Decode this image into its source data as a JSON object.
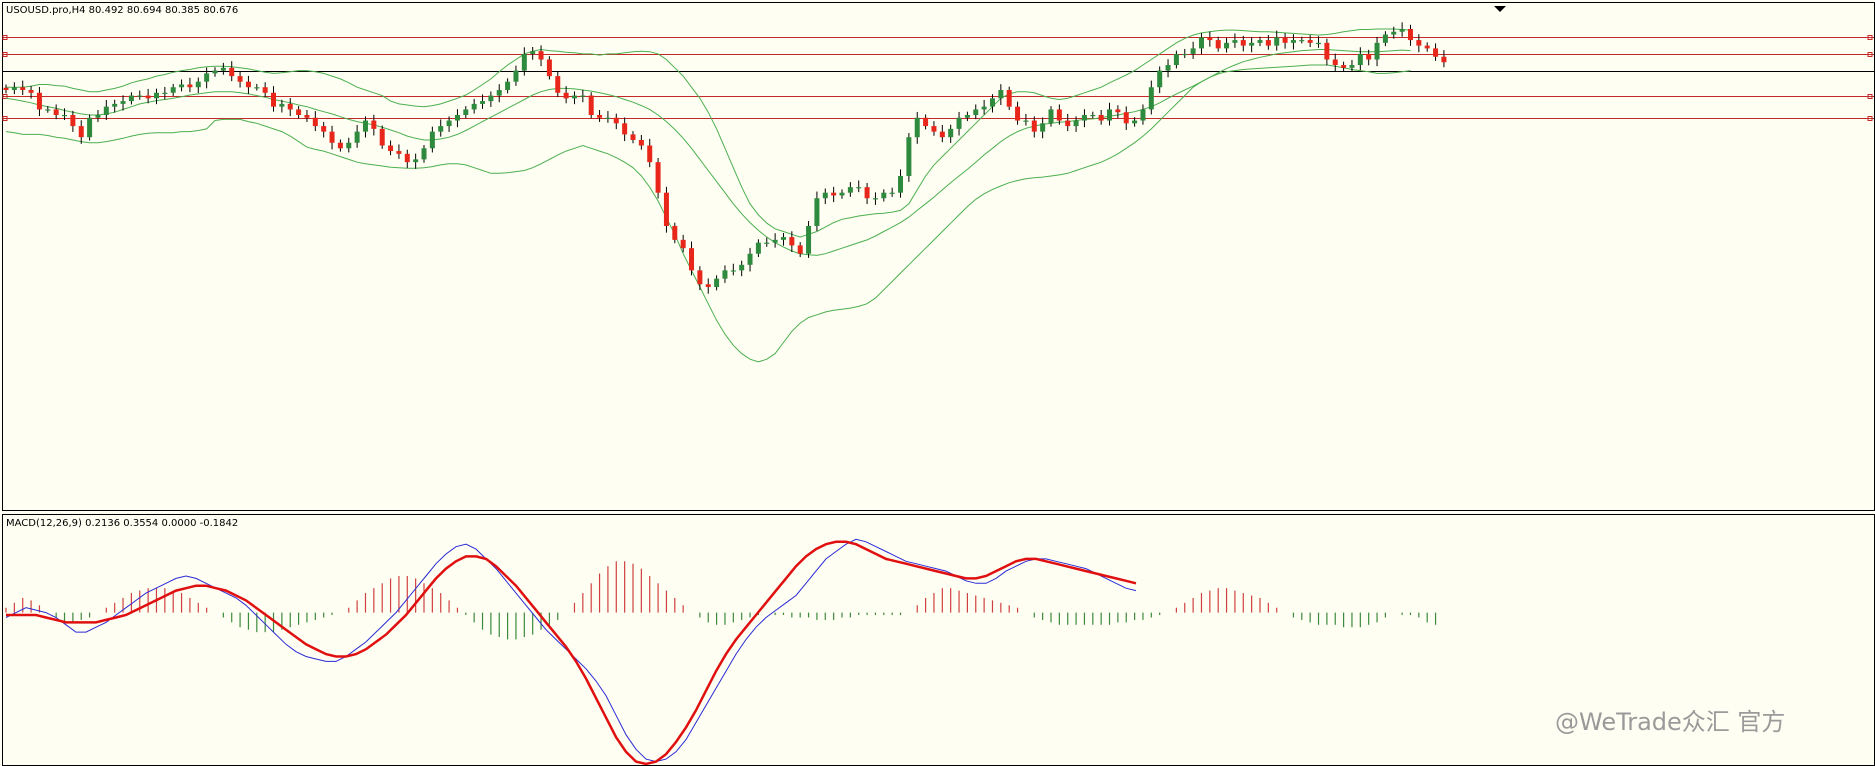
{
  "colors": {
    "background": "#fefef2",
    "frame": "#000000",
    "bull_candle": "#2e8b3e",
    "bear_candle": "#e8261a",
    "bollinger": "#4caf50",
    "level_line": "#c62828",
    "price_line": "#000000",
    "macd_line": "#2a2ad6",
    "signal_line": "#e01010",
    "hist_pos": "#d04040",
    "hist_neg": "#3c8a3c"
  },
  "header": {
    "symbol_info": "USOUSD.pro,H4  80.492 80.694 80.385 80.676"
  },
  "macd_panel": {
    "label": "MACD(12,26,9) 0.2136 0.3554 0.0000 -0.1842"
  },
  "watermark": {
    "text": "@WeTrade众汇 官方"
  },
  "chart_data": [
    {
      "type": "candlestick",
      "title": "USOUSD.pro,H4  80.492 80.694 80.385 80.676",
      "timeframe": "H4",
      "ylim": [
        74.5,
        83.6
      ],
      "levels": [
        83.0,
        82.7,
        81.95,
        81.55
      ],
      "current_price": 82.4,
      "close": [
        82.05,
        82.1,
        82.05,
        82.0,
        81.7,
        81.7,
        81.6,
        81.6,
        81.4,
        81.2,
        81.55,
        81.6,
        81.75,
        81.8,
        81.85,
        81.95,
        81.95,
        81.9,
        82.0,
        82.0,
        82.1,
        82.15,
        82.1,
        82.2,
        82.35,
        82.4,
        82.45,
        82.3,
        82.2,
        82.1,
        82.1,
        82.0,
        81.75,
        81.8,
        81.7,
        81.6,
        81.55,
        81.4,
        81.3,
        81.1,
        81.0,
        81.1,
        81.3,
        81.5,
        81.35,
        81.05,
        80.95,
        80.9,
        80.75,
        80.8,
        81.0,
        81.3,
        81.4,
        81.5,
        81.6,
        81.7,
        81.8,
        81.85,
        81.95,
        82.05,
        82.2,
        82.4,
        82.7,
        82.75,
        82.6,
        82.3,
        82.0,
        81.9,
        81.95,
        81.95,
        81.6,
        81.55,
        81.55,
        81.45,
        81.25,
        81.15,
        81.05,
        80.75,
        80.2,
        79.6,
        79.35,
        79.2,
        78.8,
        78.55,
        78.5,
        78.65,
        78.8,
        78.8,
        78.9,
        79.1,
        79.3,
        79.3,
        79.35,
        79.4,
        79.25,
        79.1,
        79.6,
        80.1,
        80.2,
        80.15,
        80.2,
        80.3,
        80.3,
        80.1,
        80.1,
        80.2,
        80.2,
        80.5,
        81.2,
        81.55,
        81.4,
        81.3,
        81.2,
        81.35,
        81.55,
        81.6,
        81.7,
        81.75,
        81.9,
        82.05,
        81.75,
        81.5,
        81.5,
        81.3,
        81.45,
        81.7,
        81.5,
        81.4,
        81.5,
        81.6,
        81.6,
        81.5,
        81.7,
        81.65,
        81.45,
        81.5,
        81.7,
        82.1,
        82.4,
        82.5,
        82.7,
        82.7,
        82.8,
        83.0,
        82.95,
        82.8,
        82.9,
        82.95,
        82.85,
        82.9,
        82.95,
        82.85,
        83.0,
        82.9,
        82.95,
        82.95,
        82.9,
        82.9,
        82.6,
        82.5,
        82.45,
        82.5,
        82.7,
        82.6,
        82.9,
        83.05,
        83.1,
        83.15,
        82.95,
        82.85,
        82.8,
        82.65,
        82.55
      ],
      "bollinger_upper": [
        82.1,
        82.1,
        82.1,
        82.12,
        82.15,
        82.15,
        82.13,
        82.12,
        82.08,
        82.05,
        82.02,
        82.02,
        82.05,
        82.08,
        82.12,
        82.18,
        82.22,
        82.25,
        82.3,
        82.33,
        82.37,
        82.4,
        82.42,
        82.45,
        82.47,
        82.48,
        82.48,
        82.47,
        82.45,
        82.43,
        82.4,
        82.37,
        82.35,
        82.36,
        82.38,
        82.4,
        82.4,
        82.38,
        82.35,
        82.3,
        82.25,
        82.18,
        82.1,
        82.05,
        82.0,
        81.95,
        81.85,
        81.8,
        81.78,
        81.76,
        81.75,
        81.77,
        81.8,
        81.85,
        81.9,
        81.96,
        82.05,
        82.15,
        82.25,
        82.38,
        82.5,
        82.6,
        82.7,
        82.75,
        82.78,
        82.76,
        82.75,
        82.73,
        82.72,
        82.7,
        82.7,
        82.68,
        82.7,
        82.7,
        82.72,
        82.74,
        82.75,
        82.74,
        82.7,
        82.6,
        82.45,
        82.3,
        82.1,
        81.9,
        81.65,
        81.35,
        81.0,
        80.65,
        80.3,
        80.0,
        79.8,
        79.65,
        79.55,
        79.5,
        79.45,
        79.4,
        79.45,
        79.5,
        79.58,
        79.66,
        79.72,
        79.75,
        79.78,
        79.8,
        79.82,
        79.83,
        79.85,
        79.88,
        80.0,
        80.25,
        80.5,
        80.7,
        80.85,
        81.0,
        81.15,
        81.3,
        81.45,
        81.6,
        81.75,
        81.9,
        81.98,
        82.02,
        82.02,
        82.0,
        81.95,
        81.9,
        81.88,
        81.9,
        81.95,
        82.0,
        82.05,
        82.1,
        82.18,
        82.25,
        82.32,
        82.4,
        82.5,
        82.6,
        82.7,
        82.8,
        82.9,
        82.98,
        83.04,
        83.08,
        83.1,
        83.12,
        83.13,
        83.13,
        83.12,
        83.11,
        83.1,
        83.1,
        83.09,
        83.08,
        83.07,
        83.06,
        83.05,
        83.04,
        83.05,
        83.07,
        83.1,
        83.12,
        83.14,
        83.14,
        83.15,
        83.15,
        83.15,
        83.14,
        83.13
      ],
      "bollinger_middle": [
        81.9,
        81.88,
        81.85,
        81.82,
        81.78,
        81.75,
        81.72,
        81.68,
        81.65,
        81.62,
        81.6,
        81.6,
        81.62,
        81.65,
        81.7,
        81.75,
        81.8,
        81.83,
        81.86,
        81.88,
        81.9,
        81.93,
        81.96,
        81.98,
        82.0,
        82.02,
        82.02,
        82.02,
        82.0,
        81.98,
        81.95,
        81.92,
        81.88,
        81.85,
        81.82,
        81.78,
        81.75,
        81.7,
        81.66,
        81.62,
        81.57,
        81.52,
        81.48,
        81.45,
        81.42,
        81.38,
        81.33,
        81.28,
        81.22,
        81.18,
        81.15,
        81.15,
        81.17,
        81.2,
        81.25,
        81.32,
        81.4,
        81.48,
        81.56,
        81.64,
        81.72,
        81.8,
        81.88,
        81.96,
        82.02,
        82.06,
        82.08,
        82.08,
        82.07,
        82.05,
        82.03,
        82.0,
        81.97,
        81.93,
        81.88,
        81.83,
        81.77,
        81.7,
        81.6,
        81.48,
        81.34,
        81.18,
        81.0,
        80.8,
        80.6,
        80.4,
        80.2,
        80.0,
        79.82,
        79.66,
        79.52,
        79.4,
        79.3,
        79.22,
        79.15,
        79.1,
        79.08,
        79.07,
        79.1,
        79.15,
        79.2,
        79.25,
        79.3,
        79.35,
        79.42,
        79.5,
        79.58,
        79.66,
        79.76,
        79.88,
        80.0,
        80.12,
        80.25,
        80.38,
        80.5,
        80.62,
        80.75,
        80.88,
        81.0,
        81.12,
        81.22,
        81.3,
        81.36,
        81.4,
        81.43,
        81.45,
        81.47,
        81.48,
        81.5,
        81.52,
        81.53,
        81.55,
        81.58,
        81.6,
        81.63,
        81.66,
        81.7,
        81.75,
        81.82,
        81.9,
        81.98,
        82.05,
        82.12,
        82.2,
        82.28,
        82.36,
        82.44,
        82.5,
        82.56,
        82.6,
        82.64,
        82.67,
        82.7,
        82.72,
        82.74,
        82.76,
        82.77,
        82.78,
        82.78,
        82.77,
        82.76,
        82.75,
        82.74,
        82.74,
        82.74,
        82.75,
        82.76,
        82.77,
        82.76
      ],
      "bollinger_lower": [
        81.3,
        81.28,
        81.25,
        81.25,
        81.25,
        81.23,
        81.2,
        81.18,
        81.15,
        81.12,
        81.1,
        81.1,
        81.12,
        81.15,
        81.18,
        81.22,
        81.25,
        81.27,
        81.28,
        81.28,
        81.28,
        81.3,
        81.3,
        81.32,
        81.35,
        81.5,
        81.52,
        81.52,
        81.52,
        81.48,
        81.45,
        81.4,
        81.35,
        81.3,
        81.22,
        81.12,
        81.02,
        80.98,
        80.95,
        80.9,
        80.85,
        80.8,
        80.75,
        80.72,
        80.7,
        80.68,
        80.66,
        80.65,
        80.64,
        80.64,
        80.65,
        80.67,
        80.7,
        80.72,
        80.72,
        80.7,
        80.65,
        80.6,
        80.55,
        80.55,
        80.56,
        80.58,
        80.6,
        80.65,
        80.72,
        80.8,
        80.88,
        80.95,
        81.0,
        81.05,
        81.0,
        80.95,
        80.9,
        80.83,
        80.75,
        80.65,
        80.5,
        80.3,
        80.05,
        79.75,
        79.45,
        79.1,
        78.8,
        78.5,
        78.2,
        77.9,
        77.65,
        77.45,
        77.3,
        77.2,
        77.15,
        77.2,
        77.3,
        77.5,
        77.7,
        77.85,
        77.95,
        78.0,
        78.05,
        78.08,
        78.1,
        78.12,
        78.15,
        78.2,
        78.3,
        78.45,
        78.6,
        78.75,
        78.9,
        79.05,
        79.2,
        79.35,
        79.5,
        79.65,
        79.8,
        79.95,
        80.08,
        80.18,
        80.26,
        80.32,
        80.38,
        80.42,
        80.45,
        80.47,
        80.48,
        80.5,
        80.52,
        80.55,
        80.6,
        80.65,
        80.7,
        80.75,
        80.82,
        80.9,
        81.0,
        81.1,
        81.22,
        81.35,
        81.5,
        81.65,
        81.8,
        81.95,
        82.1,
        82.2,
        82.28,
        82.34,
        82.38,
        82.4,
        82.42,
        82.43,
        82.44,
        82.45,
        82.46,
        82.47,
        82.48,
        82.49,
        82.5,
        82.5,
        82.5,
        82.48,
        82.45,
        82.42,
        82.4,
        82.38,
        82.35,
        82.35,
        82.36,
        82.38,
        82.4
      ]
    },
    {
      "type": "macd",
      "title": "MACD(12,26,9) 0.2136 0.3554 0.0000 -0.1842",
      "params": [
        12,
        26,
        9
      ],
      "ylim": [
        -0.62,
        0.33
      ],
      "histogram": [
        0.02,
        0.04,
        0.06,
        0.05,
        0.03,
        0.0,
        -0.02,
        -0.04,
        -0.04,
        -0.03,
        -0.02,
        0.0,
        0.02,
        0.04,
        0.06,
        0.08,
        0.09,
        0.1,
        0.1,
        0.1,
        0.09,
        0.08,
        0.06,
        0.04,
        0.02,
        0.0,
        -0.02,
        -0.04,
        -0.06,
        -0.07,
        -0.08,
        -0.08,
        -0.08,
        -0.07,
        -0.06,
        -0.05,
        -0.04,
        -0.03,
        -0.02,
        -0.01,
        0.0,
        0.02,
        0.05,
        0.08,
        0.1,
        0.12,
        0.14,
        0.15,
        0.15,
        0.14,
        0.12,
        0.1,
        0.08,
        0.05,
        0.02,
        -0.01,
        -0.04,
        -0.07,
        -0.09,
        -0.1,
        -0.11,
        -0.11,
        -0.1,
        -0.09,
        -0.07,
        -0.05,
        -0.03,
        0.0,
        0.04,
        0.08,
        0.12,
        0.16,
        0.19,
        0.21,
        0.21,
        0.2,
        0.18,
        0.15,
        0.12,
        0.09,
        0.06,
        0.03,
        0.0,
        -0.02,
        -0.04,
        -0.05,
        -0.05,
        -0.04,
        -0.03,
        -0.02,
        -0.01,
        0.0,
        -0.01,
        -0.01,
        -0.02,
        -0.02,
        -0.02,
        -0.03,
        -0.03,
        -0.03,
        -0.02,
        -0.02,
        -0.01,
        -0.01,
        -0.01,
        -0.01,
        -0.01,
        -0.01,
        0.0,
        0.03,
        0.06,
        0.08,
        0.1,
        0.1,
        0.09,
        0.08,
        0.07,
        0.06,
        0.05,
        0.04,
        0.03,
        0.02,
        0.0,
        -0.02,
        -0.03,
        -0.04,
        -0.05,
        -0.05,
        -0.05,
        -0.05,
        -0.05,
        -0.05,
        -0.05,
        -0.04,
        -0.04,
        -0.03,
        -0.03,
        -0.02,
        -0.01,
        0.0,
        0.02,
        0.04,
        0.06,
        0.08,
        0.09,
        0.1,
        0.1,
        0.09,
        0.08,
        0.07,
        0.06,
        0.04,
        0.02,
        0.0,
        -0.02,
        -0.03,
        -0.04,
        -0.05,
        -0.05,
        -0.05,
        -0.06,
        -0.06,
        -0.06,
        -0.05,
        -0.04,
        -0.02,
        0.0,
        -0.01,
        -0.01,
        -0.02,
        -0.04,
        -0.05
      ],
      "macd": [
        -0.02,
        -0.0,
        0.02,
        0.01,
        0.0,
        -0.02,
        -0.05,
        -0.08,
        -0.08,
        -0.06,
        -0.04,
        -0.01,
        0.02,
        0.05,
        0.08,
        0.1,
        0.12,
        0.14,
        0.15,
        0.14,
        0.12,
        0.1,
        0.08,
        0.06,
        0.03,
        -0.01,
        -0.05,
        -0.09,
        -0.13,
        -0.16,
        -0.18,
        -0.19,
        -0.2,
        -0.2,
        -0.18,
        -0.15,
        -0.12,
        -0.08,
        -0.04,
        0.0,
        0.05,
        0.1,
        0.15,
        0.2,
        0.24,
        0.27,
        0.28,
        0.26,
        0.22,
        0.18,
        0.13,
        0.08,
        0.03,
        -0.02,
        -0.07,
        -0.11,
        -0.15,
        -0.19,
        -0.23,
        -0.28,
        -0.34,
        -0.42,
        -0.5,
        -0.56,
        -0.6,
        -0.61,
        -0.6,
        -0.57,
        -0.52,
        -0.45,
        -0.38,
        -0.31,
        -0.24,
        -0.17,
        -0.11,
        -0.06,
        -0.02,
        0.01,
        0.04,
        0.07,
        0.12,
        0.17,
        0.22,
        0.25,
        0.28,
        0.3,
        0.29,
        0.27,
        0.25,
        0.23,
        0.21,
        0.2,
        0.19,
        0.18,
        0.17,
        0.15,
        0.13,
        0.12,
        0.12,
        0.14,
        0.17,
        0.19,
        0.21,
        0.22,
        0.22,
        0.21,
        0.2,
        0.19,
        0.18,
        0.16,
        0.14,
        0.12,
        0.1,
        0.09
      ],
      "signal": [
        -0.01,
        -0.01,
        -0.01,
        -0.01,
        -0.02,
        -0.03,
        -0.04,
        -0.04,
        -0.04,
        -0.04,
        -0.03,
        -0.02,
        -0.01,
        0.01,
        0.03,
        0.05,
        0.07,
        0.09,
        0.1,
        0.11,
        0.11,
        0.1,
        0.09,
        0.07,
        0.05,
        0.02,
        -0.01,
        -0.04,
        -0.07,
        -0.1,
        -0.13,
        -0.15,
        -0.17,
        -0.18,
        -0.18,
        -0.17,
        -0.15,
        -0.12,
        -0.09,
        -0.05,
        -0.01,
        0.04,
        0.09,
        0.14,
        0.18,
        0.21,
        0.23,
        0.23,
        0.22,
        0.19,
        0.15,
        0.11,
        0.06,
        0.01,
        -0.04,
        -0.09,
        -0.14,
        -0.2,
        -0.27,
        -0.35,
        -0.43,
        -0.51,
        -0.57,
        -0.61,
        -0.62,
        -0.61,
        -0.58,
        -0.53,
        -0.47,
        -0.4,
        -0.32,
        -0.24,
        -0.17,
        -0.11,
        -0.06,
        -0.01,
        0.04,
        0.09,
        0.14,
        0.19,
        0.23,
        0.26,
        0.28,
        0.29,
        0.29,
        0.28,
        0.26,
        0.24,
        0.22,
        0.21,
        0.2,
        0.19,
        0.18,
        0.17,
        0.16,
        0.15,
        0.14,
        0.14,
        0.15,
        0.17,
        0.19,
        0.21,
        0.22,
        0.22,
        0.21,
        0.2,
        0.19,
        0.18,
        0.17,
        0.16,
        0.15,
        0.14,
        0.13,
        0.12
      ]
    }
  ]
}
